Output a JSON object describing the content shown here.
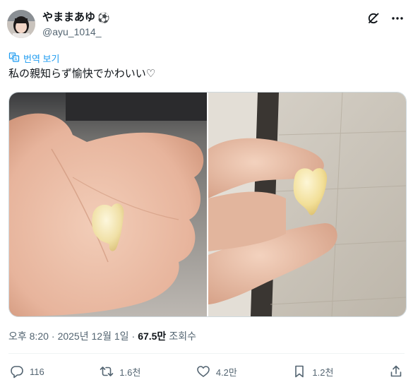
{
  "user": {
    "display_name": "やままあゆ",
    "emoji": "⚽",
    "handle": "@ayu_1014_"
  },
  "header_icons": [
    "grok-icon",
    "more-icon"
  ],
  "translate": {
    "label": "번역 보기"
  },
  "tweet": {
    "text": "私の親知らず愉快でかわいい♡"
  },
  "media": {
    "images": [
      {
        "name": "tooth-on-palm-photo"
      },
      {
        "name": "tooth-held-fingers-photo"
      }
    ]
  },
  "meta": {
    "time": "오후 8:20",
    "separator1": "·",
    "date": "2025년 12월 1일",
    "separator2": "·",
    "views_count": "67.5만",
    "views_label": "조회수"
  },
  "actions": {
    "reply": "116",
    "retweet": "1.6천",
    "like": "4.2만",
    "bookmark": "1.2천"
  },
  "colors": {
    "link": "#1d9bf0",
    "secondary_text": "#536471",
    "primary_text": "#0f1419",
    "border": "#cfd9de"
  }
}
